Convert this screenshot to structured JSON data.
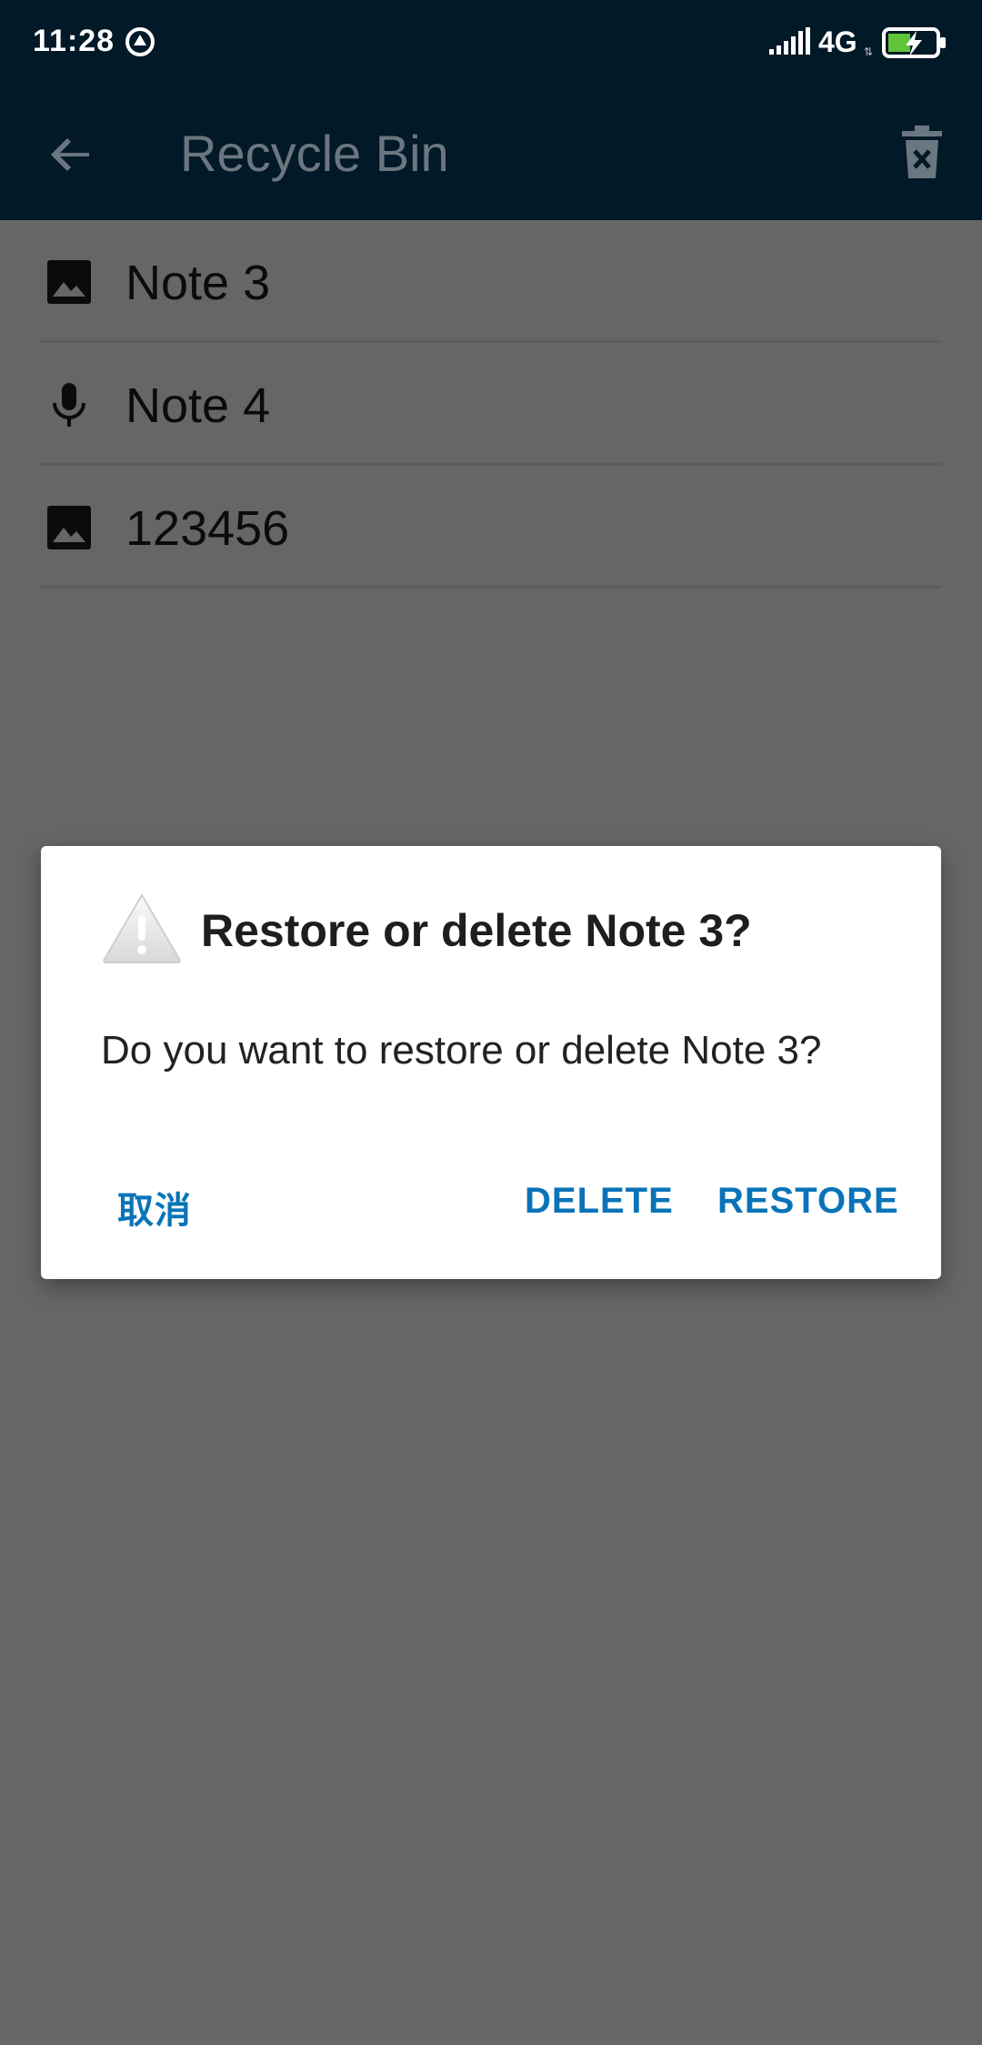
{
  "status_bar": {
    "time": "11:28",
    "network": "4G",
    "network_sub": "⇅",
    "icons": [
      "sync-icon",
      "signal-icon",
      "battery-charging-icon"
    ]
  },
  "app_bar": {
    "title": "Recycle Bin",
    "back_icon": "arrow-back-icon",
    "action_icon": "delete-forever-icon",
    "bg_color": "#021927"
  },
  "notes": [
    {
      "label": "Note 3",
      "icon": "image-icon"
    },
    {
      "label": "Note 4",
      "icon": "mic-icon"
    },
    {
      "label": "123456",
      "icon": "image-icon"
    }
  ],
  "dialog": {
    "icon": "warning-icon",
    "title": "Restore or delete Note 3?",
    "message": "Do you want to restore or delete Note 3?",
    "buttons": {
      "cancel": "取消",
      "delete": "DELETE",
      "restore": "RESTORE"
    },
    "accent_color": "#0a73b8"
  }
}
